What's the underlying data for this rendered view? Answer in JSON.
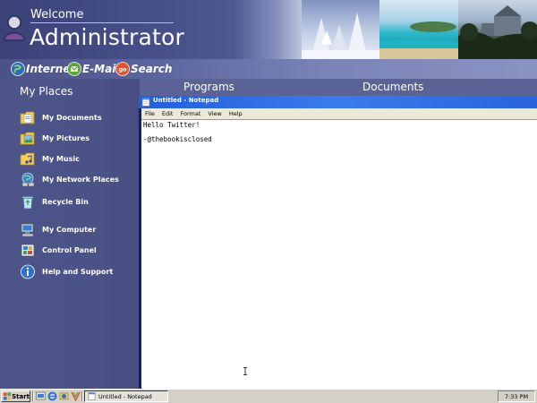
{
  "header": {
    "welcome": "Welcome",
    "user_name": "Administrator",
    "avatar_icon": "user-icon"
  },
  "quick_links": [
    {
      "label": "Internet",
      "icon": "globe-icon",
      "color": "#2a6fb8"
    },
    {
      "label": "E-Mail",
      "icon": "mail-icon",
      "color": "#5aa83a"
    },
    {
      "label": "Search",
      "icon": "go-search-icon",
      "color": "#e2532b"
    }
  ],
  "places": {
    "title": "My Places",
    "items": [
      {
        "label": "My Documents",
        "icon": "documents-folder-icon"
      },
      {
        "label": "My Pictures",
        "icon": "pictures-folder-icon"
      },
      {
        "label": "My Music",
        "icon": "music-folder-icon"
      },
      {
        "label": "My Network Places",
        "icon": "network-places-icon"
      },
      {
        "label": "Recycle Bin",
        "icon": "recycle-bin-icon"
      },
      {
        "label": "My Computer",
        "icon": "computer-icon"
      },
      {
        "label": "Control Panel",
        "icon": "control-panel-icon"
      },
      {
        "label": "Help and Support",
        "icon": "help-icon"
      }
    ]
  },
  "sections": {
    "programs": "Programs",
    "documents": "Documents"
  },
  "notepad": {
    "title": "Untitled - Notepad",
    "menu": [
      "File",
      "Edit",
      "Format",
      "View",
      "Help"
    ],
    "lines": [
      "Hello Twitter!",
      "",
      "-@thebookisclosed"
    ]
  },
  "taskbar": {
    "start_label": "Start",
    "task_label": "Untitled - Notepad",
    "clock": "7:33 PM"
  },
  "colors": {
    "desktop": "#5a6296",
    "titlebar": "#2a63dc",
    "accent": "#0a246a"
  }
}
